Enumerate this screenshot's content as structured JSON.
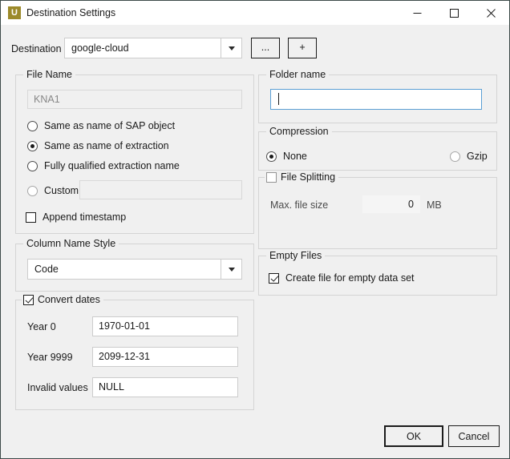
{
  "window": {
    "title": "Destination Settings",
    "icon": "app-icon-u",
    "icon_letter": "U",
    "icon_color": "#9c8a2a",
    "controls": {
      "minimize": "minimize-icon",
      "maximize": "maximize-icon",
      "close": "close-icon"
    }
  },
  "destination": {
    "label": "Destination",
    "value": "google-cloud",
    "browse_label": "...",
    "add_label": "+"
  },
  "file_name": {
    "group_label": "File Name",
    "preview_value": "KNA1",
    "options": [
      {
        "label": "Same as name of SAP object",
        "selected": false,
        "enabled": true
      },
      {
        "label": "Same as name of extraction",
        "selected": true,
        "enabled": true
      },
      {
        "label": "Fully qualified extraction name",
        "selected": false,
        "enabled": true
      },
      {
        "label": "Custom",
        "selected": false,
        "enabled": false
      }
    ],
    "custom_value": "",
    "append_timestamp": {
      "label": "Append timestamp",
      "checked": false
    }
  },
  "column_name_style": {
    "group_label": "Column Name Style",
    "value": "Code"
  },
  "convert_dates": {
    "group_label": "Convert dates",
    "checked": true,
    "fields": [
      {
        "label": "Year 0",
        "value": "1970-01-01"
      },
      {
        "label": "Year 9999",
        "value": "2099-12-31"
      },
      {
        "label": "Invalid values",
        "value": "NULL"
      }
    ]
  },
  "folder_name": {
    "group_label": "Folder name",
    "value": "",
    "focused": true
  },
  "compression": {
    "group_label": "Compression",
    "options": [
      {
        "label": "None",
        "selected": true
      },
      {
        "label": "Gzip",
        "selected": false
      }
    ]
  },
  "file_splitting": {
    "group_label": "File Splitting",
    "checked": false,
    "max_size_label": "Max. file size",
    "max_size_value": "0",
    "unit_label": "MB"
  },
  "empty_files": {
    "group_label": "Empty Files",
    "option": {
      "label": "Create file for empty data set",
      "checked": true
    }
  },
  "footer": {
    "ok_label": "OK",
    "cancel_label": "Cancel"
  }
}
